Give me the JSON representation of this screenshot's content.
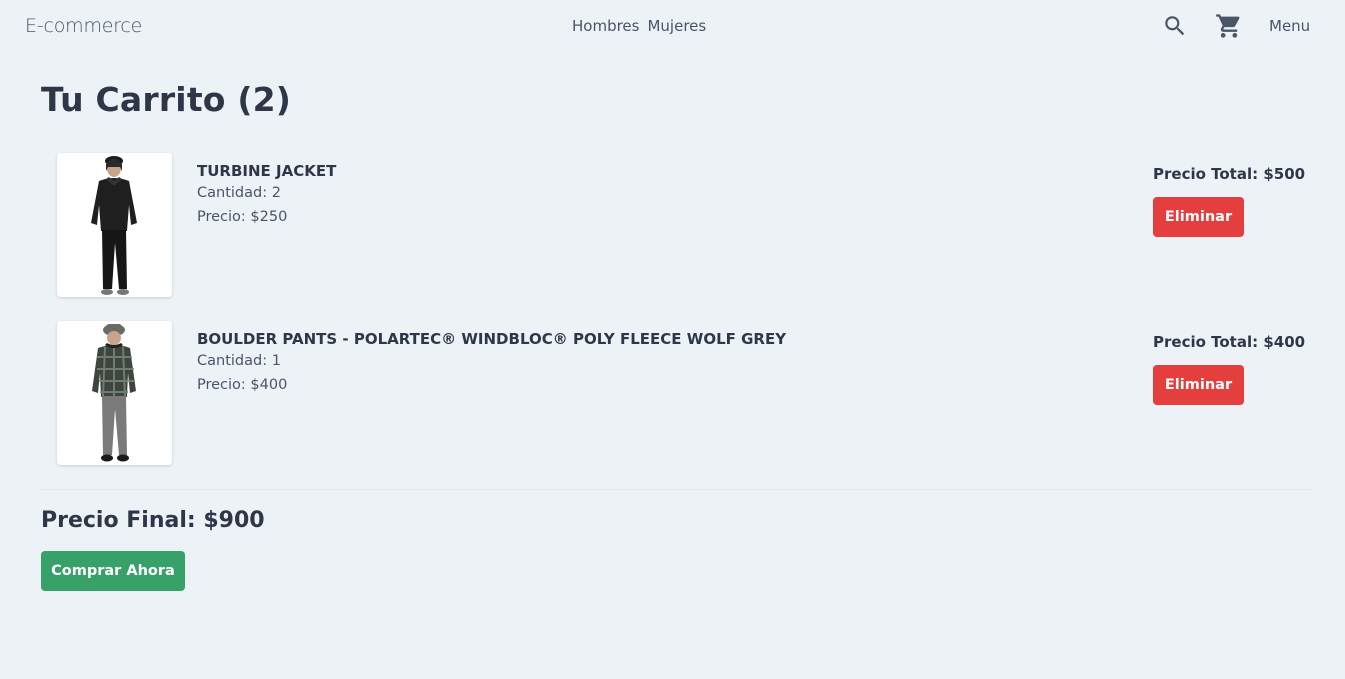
{
  "header": {
    "brand": "E-commerce",
    "nav": [
      "Hombres",
      "Mujeres"
    ],
    "search_icon": "search-icon",
    "cart_icon": "cart-icon",
    "menu_label": "Menu"
  },
  "cart": {
    "title": "Tu Carrito (2)",
    "items": [
      {
        "name": "TURBINE JACKET",
        "quantity": "Cantidad: 2",
        "price": "Precio: $250",
        "total": "Precio Total: $500",
        "remove_label": "Eliminar",
        "image": "product-photo-black-jacket"
      },
      {
        "name": "BOULDER PANTS - POLARTEC® WINDBLOC® POLY FLEECE WOLF GREY",
        "quantity": "Cantidad: 1",
        "price": "Precio: $400",
        "total": "Precio Total: $400",
        "remove_label": "Eliminar",
        "image": "product-photo-plaid-jacket-grey-pants"
      }
    ],
    "final_price": "Precio Final: $900",
    "buy_label": "Comprar Ahora"
  },
  "colors": {
    "background": "#edf2f7",
    "text": "#2d3748",
    "danger": "#e53e3e",
    "success": "#38a169"
  }
}
